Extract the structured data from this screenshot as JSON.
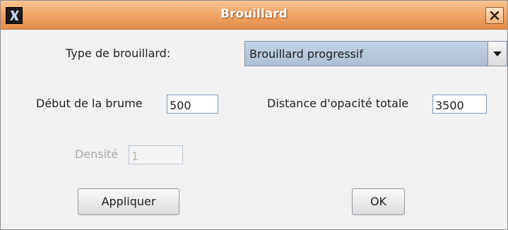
{
  "window": {
    "title": "Brouillard",
    "icon": "x-app-icon",
    "close_icon": "close-icon"
  },
  "form": {
    "fog_type": {
      "label": "Type de brouillard:",
      "selected": "Brouillard progressif",
      "arrow_icon": "chevron-down-icon"
    },
    "fog_start": {
      "label": "Début de la brume",
      "value": "500"
    },
    "opacity_distance": {
      "label": "Distance d'opacité totale",
      "value": "3500"
    },
    "density": {
      "label": "Densité",
      "value": "1",
      "enabled": false
    }
  },
  "buttons": {
    "apply": "Appliquer",
    "ok": "OK"
  }
}
